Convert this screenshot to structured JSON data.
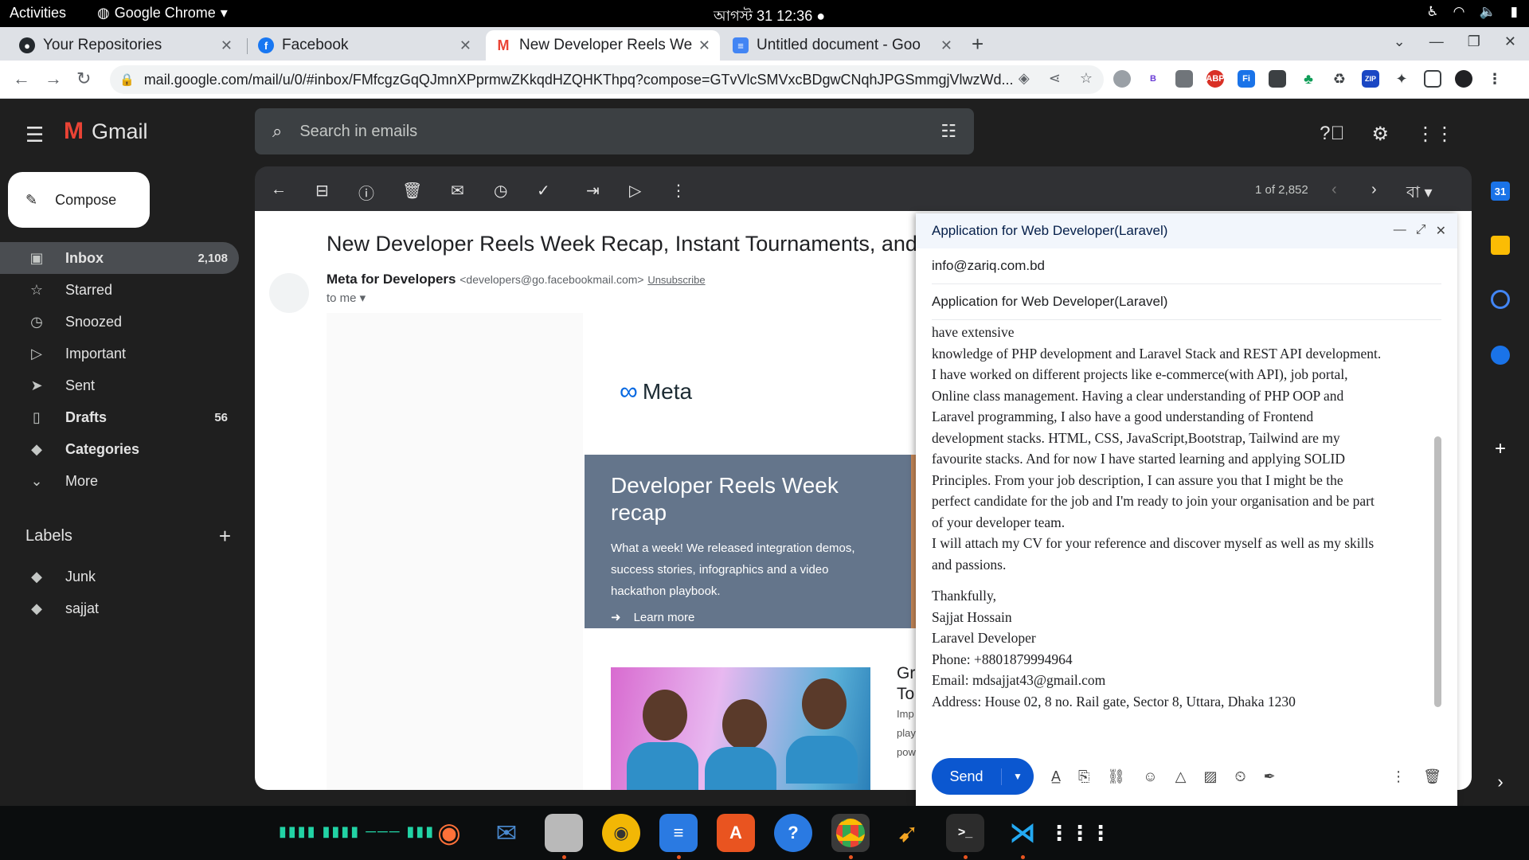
{
  "system": {
    "activities": "Activities",
    "app_name": "Google Chrome",
    "clock": "আগস্ট 31  12:36"
  },
  "tabs": [
    {
      "label": "Your Repositories",
      "icon": "github-icon"
    },
    {
      "label": "Facebook",
      "icon": "facebook-icon"
    },
    {
      "label": "New Developer Reels We",
      "icon": "gmail-icon",
      "active": true
    },
    {
      "label": "Untitled document - Goo",
      "icon": "docs-icon"
    }
  ],
  "omnibox": {
    "url": "mail.google.com/mail/u/0/#inbox/FMfcgzGqQJmnXPprmwZKkqdHZQHKThpq?compose=GTvVlcSMVxcBDgwCNqhJPGSmmgjVlwzWd..."
  },
  "gmail": {
    "brand": "Gmail",
    "search_placeholder": "Search in emails",
    "compose_label": "Compose",
    "nav": [
      {
        "label": "Inbox",
        "count": "2,108",
        "icon": "inbox-icon"
      },
      {
        "label": "Starred",
        "count": "",
        "icon": "star-icon"
      },
      {
        "label": "Snoozed",
        "count": "",
        "icon": "clock-icon"
      },
      {
        "label": "Important",
        "count": "",
        "icon": "important-icon"
      },
      {
        "label": "Sent",
        "count": "",
        "icon": "send-icon"
      },
      {
        "label": "Drafts",
        "count": "56",
        "icon": "draft-icon"
      },
      {
        "label": "Categories",
        "count": "",
        "icon": "label-icon"
      },
      {
        "label": "More",
        "count": "",
        "icon": "chevron-down-icon"
      }
    ],
    "labels_header": "Labels",
    "labels": [
      "Junk",
      "sajjat"
    ],
    "pagination": "1 of 2,852",
    "lang_button": "বা"
  },
  "email": {
    "subject": "New Developer Reels Week Recap, Instant Tournaments, and",
    "sender_name": "Meta for Developers",
    "sender_email": "<developers@go.facebookmail.com>",
    "unsubscribe": "Unsubscribe",
    "to": "to me",
    "meta_logo": "Meta",
    "hero_title": "Developer Reels Week recap",
    "hero_text": "What a week! We released integration demos, success stories, infographics and a video hackathon playbook.",
    "learn_more": "Learn more",
    "promo2_title_line1": "Gr",
    "promo2_title_line2": "To",
    "promo2_text_line1": "Imp",
    "promo2_text_line2": "play",
    "promo2_text_line3": "pow"
  },
  "compose": {
    "title": "Application for Web Developer(Laravel)",
    "to": "info@zariq.com.bd",
    "subject": "Application for Web Developer(Laravel)",
    "body_lines": [
      "have extensive",
      "knowledge of PHP development and Laravel Stack and REST API development.",
      "I have worked on different projects like e-commerce(with API), job portal,",
      "Online class management. Having a clear understanding of PHP OOP and",
      "Laravel programming, I also have a good understanding of Frontend",
      "development stacks. HTML, CSS, JavaScript,Bootstrap, Tailwind are my",
      "favourite stacks. And for now I have started learning and applying SOLID",
      "Principles. From your job description, I can assure you that I might be the",
      "perfect candidate for the job and I'm ready to join your organisation and be part",
      "of your developer team.",
      "I will attach my CV for your reference and discover myself as well as my skills",
      "and passions."
    ],
    "signature_lines": [
      "Thankfully,",
      "Sajjat Hossain",
      "Laravel Developer",
      "Phone: +8801879994964",
      "Email: mdsajjat43@gmail.com",
      "Address: House 02, 8 no. Rail gate, Sector 8, Uttara, Dhaka 1230"
    ],
    "send_label": "Send"
  }
}
